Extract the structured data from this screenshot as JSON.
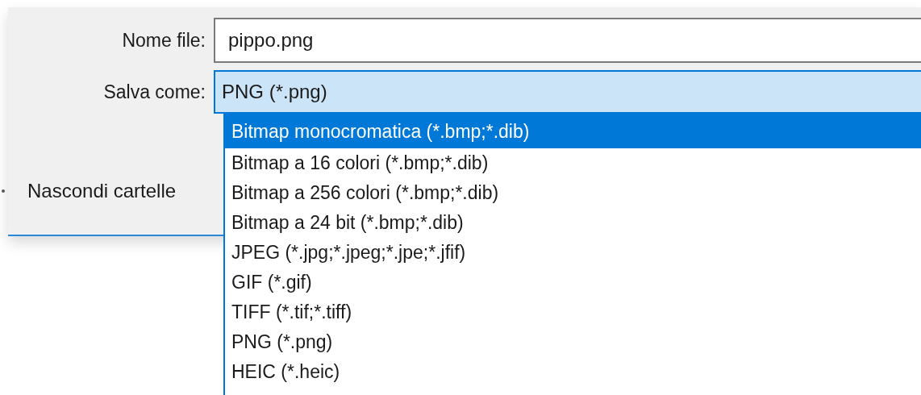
{
  "file_name": {
    "label": "Nome file:",
    "value": "pippo.png"
  },
  "save_as": {
    "label": "Salva come:",
    "value": "PNG (*.png)",
    "expanded": true
  },
  "hide_folders": {
    "label": "Nascondi cartelle"
  },
  "file_types": [
    {
      "label": "Bitmap monocromatica (*.bmp;*.dib)",
      "selected": true
    },
    {
      "label": "Bitmap a 16 colori (*.bmp;*.dib)",
      "selected": false
    },
    {
      "label": "Bitmap a 256 colori (*.bmp;*.dib)",
      "selected": false
    },
    {
      "label": "Bitmap a 24 bit (*.bmp;*.dib)",
      "selected": false
    },
    {
      "label": "JPEG (*.jpg;*.jpeg;*.jpe;*.jfif)",
      "selected": false
    },
    {
      "label": "GIF (*.gif)",
      "selected": false
    },
    {
      "label": "TIFF (*.tif;*.tiff)",
      "selected": false
    },
    {
      "label": "PNG (*.png)",
      "selected": false
    },
    {
      "label": "HEIC (*.heic)",
      "selected": false
    }
  ]
}
